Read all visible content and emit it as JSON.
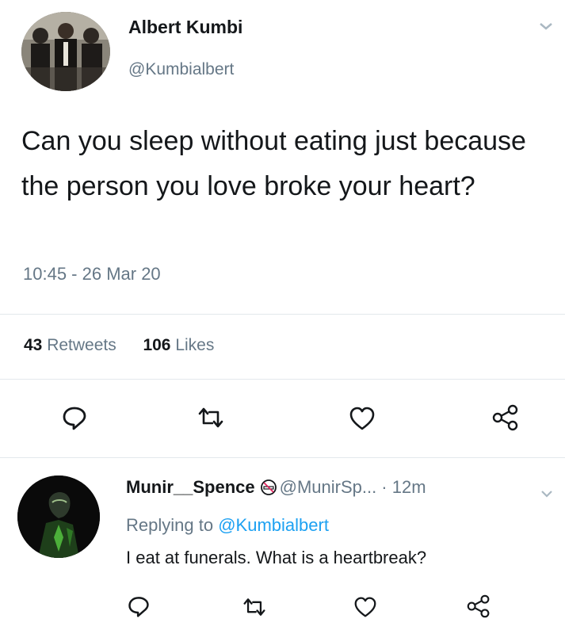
{
  "tweet": {
    "author_name": "Albert Kumbi",
    "author_handle": "@Kumbialbert",
    "text": "Can you sleep without eating just because the person you love broke your heart?",
    "timestamp": "10:45 - 26 Mar 20",
    "retweet_count": "43",
    "retweet_label": "Retweets",
    "like_count": "106",
    "like_label": "Likes",
    "actions": [
      "reply-icon",
      "retweet-icon",
      "like-icon",
      "share-icon"
    ]
  },
  "reply": {
    "author_name": "Munir__Spence",
    "badge_icon": "no-smoking-icon",
    "handle_time": "@MunirSp... · 12m",
    "replying_prefix": "Replying to",
    "replying_to": "@Kumbialbert",
    "text": "I eat at funerals. What is a heartbreak?",
    "actions": [
      "reply-icon",
      "retweet-icon",
      "like-icon",
      "share-icon"
    ]
  },
  "colors": {
    "text": "#14171a",
    "secondary": "#657786",
    "link": "#1da1f2",
    "badge_red": "#e0245e"
  }
}
